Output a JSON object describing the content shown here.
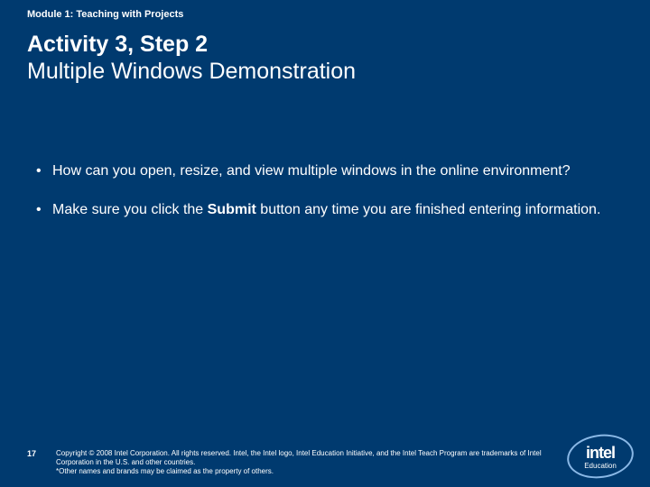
{
  "header": {
    "module": "Module 1: Teaching with Projects"
  },
  "title": {
    "line1": "Activity 3, Step 2",
    "line2": "Multiple Windows Demonstration"
  },
  "bullets": [
    {
      "pre": "How can you open, resize, and view multiple windows in the online environment?",
      "bold": "",
      "post": ""
    },
    {
      "pre": "Make sure you click the ",
      "bold": "Submit",
      "post": " button any time you are finished entering information."
    }
  ],
  "footer": {
    "slide_number": "17",
    "copyright_l1": "Copyright © 2008 Intel Corporation. All rights reserved. Intel, the Intel logo, Intel Education Initiative, and the Intel Teach Program are trademarks of Intel Corporation in the U.S. and other countries.",
    "copyright_l2": "*Other names and brands may be claimed as the property of others."
  },
  "logo": {
    "brand": "intel",
    "sub": "Education"
  }
}
